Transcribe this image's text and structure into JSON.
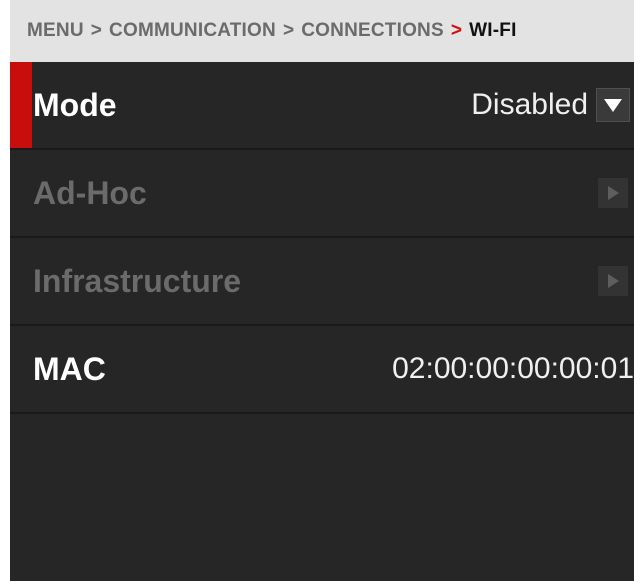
{
  "breadcrumb": {
    "items": [
      "MENU",
      "COMMUNICATION",
      "CONNECTIONS",
      "WI-FI"
    ],
    "separator": ">",
    "active_separator_color": "#d01010"
  },
  "rows": {
    "mode": {
      "label": "Mode",
      "value": "Disabled",
      "control_icon": "chevron-down-icon",
      "selected": true
    },
    "adhoc": {
      "label": "Ad-Hoc",
      "control_icon": "chevron-right-icon",
      "enabled": false
    },
    "infrastructure": {
      "label": "Infrastructure",
      "control_icon": "chevron-right-icon",
      "enabled": false
    },
    "mac": {
      "label": "MAC",
      "value": "02:00:00:00:00:01"
    }
  },
  "colors": {
    "panel_bg": "#262626",
    "selection_accent": "#c80d0d",
    "breadcrumb_bg": "#e3e3e3"
  }
}
